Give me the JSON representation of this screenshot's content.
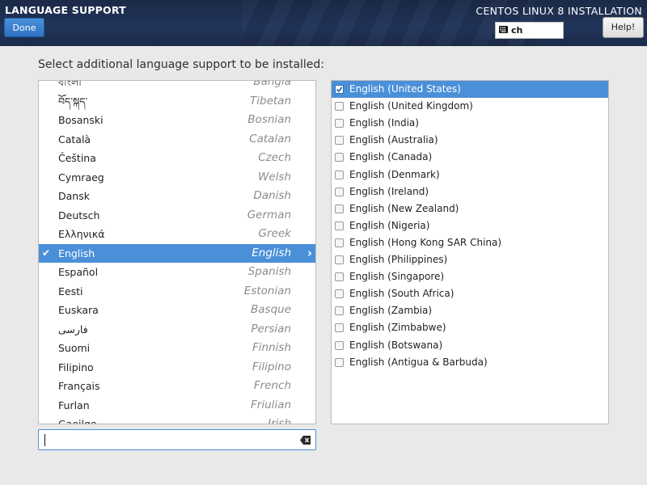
{
  "header": {
    "screen_title": "LANGUAGE SUPPORT",
    "done_label": "Done",
    "product_title": "CENTOS LINUX 8 INSTALLATION",
    "keyboard_layout": "ch",
    "help_label": "Help!",
    "keyboard_icon": "keyboard-icon"
  },
  "prompt": "Select additional language support to be installed:",
  "languages": [
    {
      "native": "বাংলা",
      "english": "Bangla"
    },
    {
      "native": "བོད་སྐད་",
      "english": "Tibetan"
    },
    {
      "native": "Bosanski",
      "english": "Bosnian"
    },
    {
      "native": "Català",
      "english": "Catalan"
    },
    {
      "native": "Čeština",
      "english": "Czech"
    },
    {
      "native": "Cymraeg",
      "english": "Welsh"
    },
    {
      "native": "Dansk",
      "english": "Danish"
    },
    {
      "native": "Deutsch",
      "english": "German"
    },
    {
      "native": "Ελληνικά",
      "english": "Greek"
    },
    {
      "native": "English",
      "english": "English",
      "selected": true
    },
    {
      "native": "Español",
      "english": "Spanish"
    },
    {
      "native": "Eesti",
      "english": "Estonian"
    },
    {
      "native": "Euskara",
      "english": "Basque"
    },
    {
      "native": "فارسی",
      "english": "Persian"
    },
    {
      "native": "Suomi",
      "english": "Finnish"
    },
    {
      "native": "Filipino",
      "english": "Filipino"
    },
    {
      "native": "Français",
      "english": "French"
    },
    {
      "native": "Furlan",
      "english": "Friulian"
    },
    {
      "native": "Gaeilge",
      "english": "Irish"
    }
  ],
  "search": {
    "value": "",
    "placeholder": "",
    "clear_icon": "clear-text-icon"
  },
  "locales": [
    {
      "label": "English (United States)",
      "checked": true
    },
    {
      "label": "English (United Kingdom)",
      "checked": false
    },
    {
      "label": "English (India)",
      "checked": false
    },
    {
      "label": "English (Australia)",
      "checked": false
    },
    {
      "label": "English (Canada)",
      "checked": false
    },
    {
      "label": "English (Denmark)",
      "checked": false
    },
    {
      "label": "English (Ireland)",
      "checked": false
    },
    {
      "label": "English (New Zealand)",
      "checked": false
    },
    {
      "label": "English (Nigeria)",
      "checked": false
    },
    {
      "label": "English (Hong Kong SAR China)",
      "checked": false
    },
    {
      "label": "English (Philippines)",
      "checked": false
    },
    {
      "label": "English (Singapore)",
      "checked": false
    },
    {
      "label": "English (South Africa)",
      "checked": false
    },
    {
      "label": "English (Zambia)",
      "checked": false
    },
    {
      "label": "English (Zimbabwe)",
      "checked": false
    },
    {
      "label": "English (Botswana)",
      "checked": false
    },
    {
      "label": "English (Antigua & Barbuda)",
      "checked": false
    }
  ],
  "colors": {
    "accent": "#4a90d9",
    "header_bg": "#1f3050",
    "page_bg": "#e9e9e9"
  }
}
